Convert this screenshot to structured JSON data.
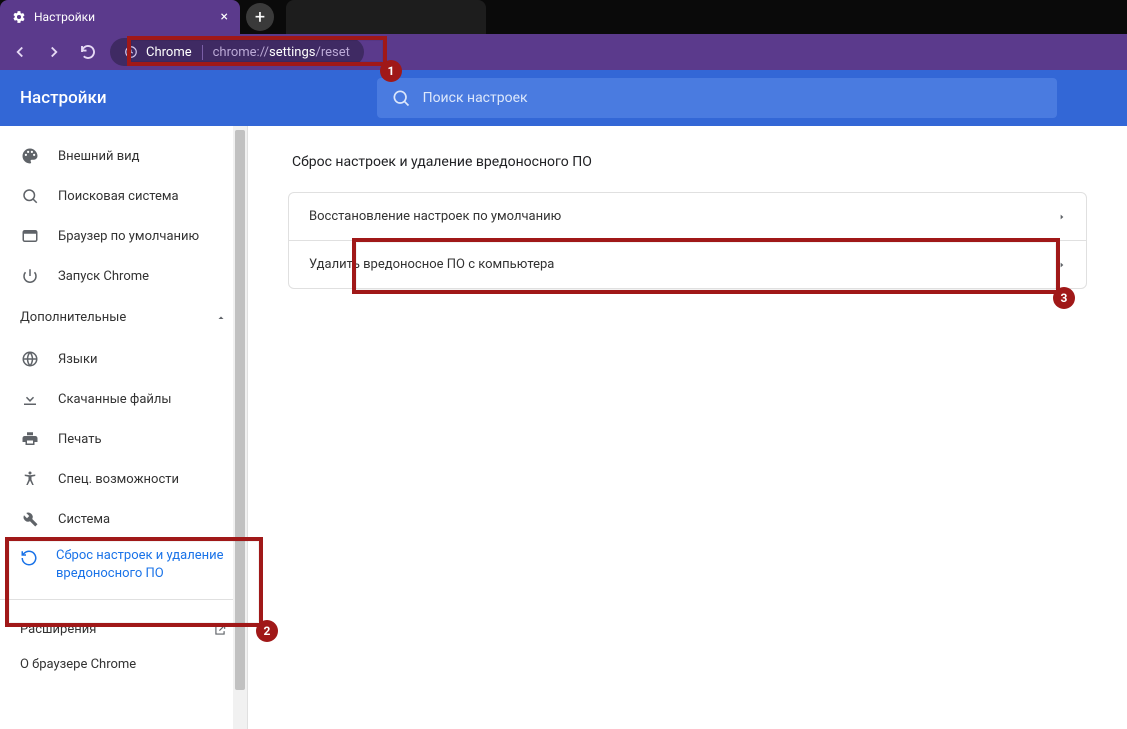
{
  "browser": {
    "active_tab_title": "Настройки",
    "address_label": "Chrome",
    "url_prefix": "chrome://",
    "url_mid": "settings",
    "url_suffix": "/reset"
  },
  "header": {
    "title": "Настройки",
    "search_placeholder": "Поиск настроек"
  },
  "sidebar": {
    "items_top": [
      {
        "icon": "palette",
        "label": "Внешний вид"
      },
      {
        "icon": "search",
        "label": "Поисковая система"
      },
      {
        "icon": "browser",
        "label": "Браузер по умолчанию"
      },
      {
        "icon": "power",
        "label": "Запуск Chrome"
      }
    ],
    "advanced_label": "Дополнительные",
    "items_advanced": [
      {
        "icon": "globe",
        "label": "Языки"
      },
      {
        "icon": "download",
        "label": "Скачанные файлы"
      },
      {
        "icon": "print",
        "label": "Печать"
      },
      {
        "icon": "a11y",
        "label": "Спец. возможности"
      },
      {
        "icon": "wrench",
        "label": "Система"
      },
      {
        "icon": "restore",
        "label": "Сброс настроек и удаление вредоносного ПО"
      }
    ],
    "extensions_label": "Расширения",
    "about_label": "О браузере Chrome"
  },
  "content": {
    "section_title": "Сброс настроек и удаление вредоносного ПО",
    "rows": [
      "Восстановление настроек по умолчанию",
      "Удалить вредоносное ПО с компьютера"
    ]
  },
  "annotations": {
    "badge1": "1",
    "badge2": "2",
    "badge3": "3"
  }
}
